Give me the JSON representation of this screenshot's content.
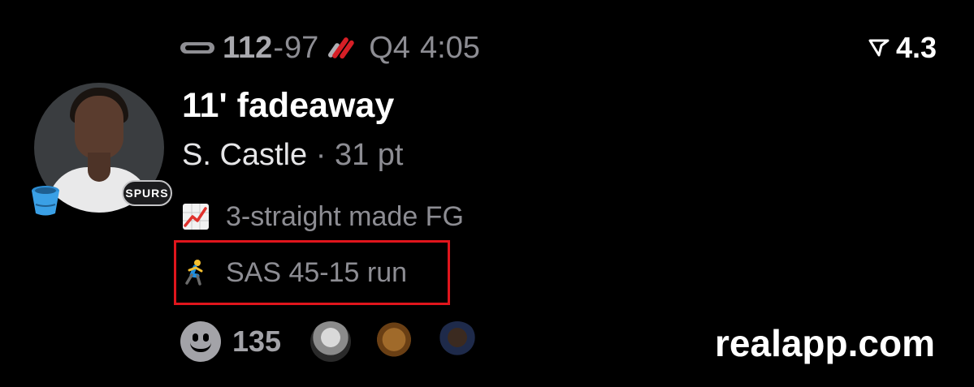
{
  "score": {
    "home_team_logo": "spurs-logo",
    "home_score": "112",
    "separator": "-",
    "away_score": "97",
    "away_team_logo": "trail-blazers-logo",
    "period": "Q4",
    "clock": "4:05"
  },
  "rating": {
    "icon": "rating-flag-icon",
    "value": "4.3"
  },
  "player": {
    "avatar": "player-headshot",
    "badge_left": "bucket-icon",
    "badge_right": "SPURS",
    "name": "S. Castle",
    "dot": "·",
    "points": "31 pt"
  },
  "headline": "11' fadeaway",
  "stats": [
    {
      "icon": "chart-increasing-icon",
      "text": "3-straight made FG"
    },
    {
      "icon": "runner-icon",
      "text": "SAS 45-15 run",
      "highlighted": true
    }
  ],
  "reactions": {
    "icon": "smiley-icon",
    "count": "135",
    "avatars": [
      "reactor-avatar-1",
      "reactor-avatar-2",
      "reactor-avatar-3"
    ]
  },
  "watermark": "realapp.com",
  "colors": {
    "background": "#000000",
    "primary_text": "#ffffff",
    "secondary_text": "#8d8d93",
    "highlight_border": "#e0151c",
    "blazers_red": "#d61f26"
  }
}
